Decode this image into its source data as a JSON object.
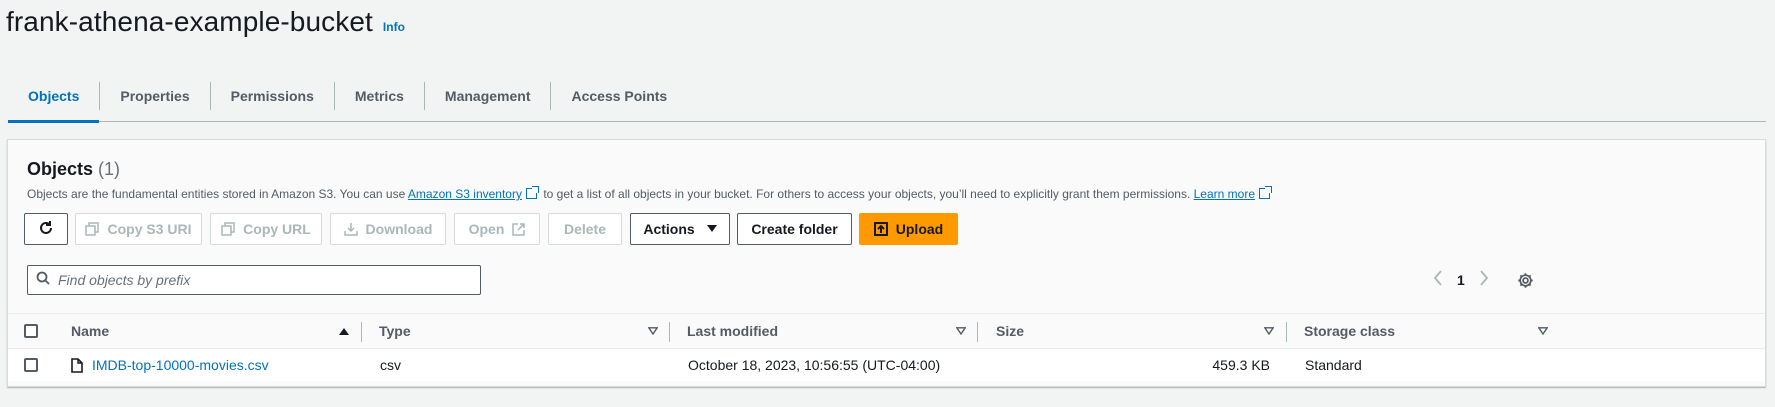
{
  "header": {
    "title": "frank-athena-example-bucket",
    "info": "Info"
  },
  "tabs": [
    {
      "label": "Objects",
      "active": true
    },
    {
      "label": "Properties",
      "active": false
    },
    {
      "label": "Permissions",
      "active": false
    },
    {
      "label": "Metrics",
      "active": false
    },
    {
      "label": "Management",
      "active": false
    },
    {
      "label": "Access Points",
      "active": false
    }
  ],
  "objects_panel": {
    "title": "Objects",
    "count": "(1)",
    "description_before": "Objects are the fundamental entities stored in Amazon S3. You can use ",
    "inventory_link": "Amazon S3 inventory",
    "description_middle": " to get a list of all objects in your bucket. For others to access your objects, you’ll need to explicitly grant them permissions. ",
    "learn_more_link": "Learn more"
  },
  "toolbar": {
    "refresh_icon": "refresh-icon",
    "copy_s3_uri": "Copy S3 URI",
    "copy_url": "Copy URL",
    "download": "Download",
    "open": "Open",
    "delete": "Delete",
    "actions": "Actions",
    "create_folder": "Create folder",
    "upload": "Upload"
  },
  "search": {
    "placeholder": "Find objects by prefix",
    "value": ""
  },
  "pagination": {
    "current_page": "1"
  },
  "table": {
    "columns": [
      "Name",
      "Type",
      "Last modified",
      "Size",
      "Storage class"
    ],
    "rows": [
      {
        "name": "IMDB-top-10000-movies.csv",
        "type": "csv",
        "last_modified": "October 18, 2023, 10:56:55 (UTC-04:00)",
        "size": "459.3 KB",
        "storage_class": "Standard"
      }
    ]
  },
  "colors": {
    "accent": "#0073bb",
    "primary_button": "#ff9900",
    "text": "#16191f",
    "muted": "#545b64"
  }
}
